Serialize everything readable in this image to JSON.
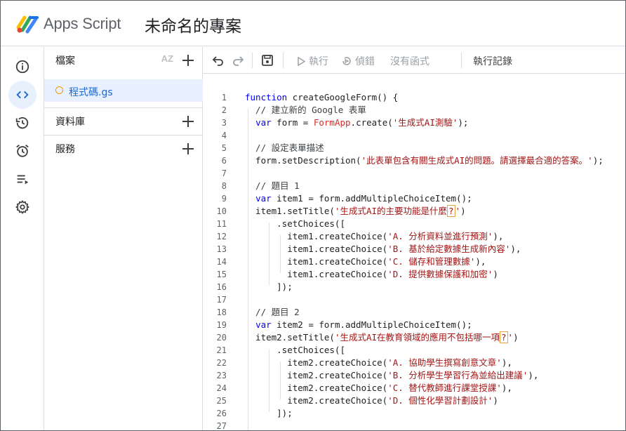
{
  "header": {
    "app_name": "Apps Script",
    "project_title": "未命名的專案"
  },
  "rail": {
    "items": [
      {
        "name": "overview",
        "icon": "info-icon"
      },
      {
        "name": "editor",
        "icon": "code-icon",
        "active": true
      },
      {
        "name": "versions",
        "icon": "history-icon"
      },
      {
        "name": "triggers",
        "icon": "alarm-icon"
      },
      {
        "name": "executions",
        "icon": "executions-list-icon"
      },
      {
        "name": "settings",
        "icon": "gear-icon"
      }
    ]
  },
  "files_panel": {
    "files_label": "檔案",
    "sort_label": "AZ",
    "file_name": "程式碼.gs",
    "libraries_label": "資料庫",
    "services_label": "服務"
  },
  "toolbar": {
    "run_label": "執行",
    "debug_label": "偵錯",
    "function_label": "沒有函式",
    "log_label": "執行記錄"
  },
  "colors": {
    "accent": "#1967d2",
    "active_bg": "#e8f0fe",
    "keyword": "#0000ff",
    "string": "#a31515",
    "file_dot": "#f29900"
  },
  "editor": {
    "lines": [
      {
        "n": "1",
        "parts": [
          [
            "kw",
            "function"
          ],
          [
            "t",
            " createGoogleForm() {"
          ]
        ]
      },
      {
        "n": "2",
        "parts": [
          [
            "cmt",
            "  // 建立新的 Google 表單"
          ]
        ]
      },
      {
        "n": "3",
        "parts": [
          [
            "t",
            "  "
          ],
          [
            "kw",
            "var"
          ],
          [
            "t",
            " form = "
          ],
          [
            "cls",
            "FormApp"
          ],
          [
            "t",
            ".create("
          ],
          [
            "str",
            "'生成式AI測驗'"
          ],
          [
            "t",
            ");"
          ]
        ]
      },
      {
        "n": "4",
        "parts": []
      },
      {
        "n": "5",
        "parts": [
          [
            "cmt",
            "  // 設定表單描述"
          ]
        ]
      },
      {
        "n": "6",
        "parts": [
          [
            "t",
            "  form.setDescription("
          ],
          [
            "str",
            "'此表單包含有關生成式AI的問題。請選擇最合適的答案。'"
          ],
          [
            "t",
            ");"
          ]
        ]
      },
      {
        "n": "7",
        "parts": []
      },
      {
        "n": "8",
        "parts": [
          [
            "cmt",
            "  // 題目 1"
          ]
        ]
      },
      {
        "n": "9",
        "parts": [
          [
            "t",
            "  "
          ],
          [
            "kw",
            "var"
          ],
          [
            "t",
            " item1 = form.addMultipleChoiceItem();"
          ]
        ]
      },
      {
        "n": "10",
        "parts": [
          [
            "t",
            "  item1.setTitle("
          ],
          [
            "str",
            "'生成式AI的主要功能是什麼"
          ],
          [
            "hl",
            "?"
          ],
          [
            "str",
            "'"
          ],
          [
            "t",
            ")"
          ]
        ]
      },
      {
        "n": "11",
        "parts": [
          [
            "t",
            "      .setChoices(["
          ]
        ]
      },
      {
        "n": "12",
        "parts": [
          [
            "t",
            "        item1.createChoice("
          ],
          [
            "str",
            "'A. 分析資料並進行預測'"
          ],
          [
            "t",
            "),"
          ]
        ]
      },
      {
        "n": "13",
        "parts": [
          [
            "t",
            "        item1.createChoice("
          ],
          [
            "str",
            "'B. 基於給定數據生成新內容'"
          ],
          [
            "t",
            "),"
          ]
        ]
      },
      {
        "n": "14",
        "parts": [
          [
            "t",
            "        item1.createChoice("
          ],
          [
            "str",
            "'C. 儲存和管理數據'"
          ],
          [
            "t",
            "),"
          ]
        ]
      },
      {
        "n": "15",
        "parts": [
          [
            "t",
            "        item1.createChoice("
          ],
          [
            "str",
            "'D. 提供數據保護和加密'"
          ],
          [
            "t",
            ")"
          ]
        ]
      },
      {
        "n": "16",
        "parts": [
          [
            "t",
            "      ]);"
          ]
        ]
      },
      {
        "n": "17",
        "parts": []
      },
      {
        "n": "18",
        "parts": [
          [
            "cmt",
            "  // 題目 2"
          ]
        ]
      },
      {
        "n": "19",
        "parts": [
          [
            "t",
            "  "
          ],
          [
            "kw",
            "var"
          ],
          [
            "t",
            " item2 = form.addMultipleChoiceItem();"
          ]
        ]
      },
      {
        "n": "20",
        "parts": [
          [
            "t",
            "  item2.setTitle("
          ],
          [
            "str",
            "'生成式AI在教育領域的應用不包括哪一項"
          ],
          [
            "hl",
            "?"
          ],
          [
            "str",
            "'"
          ],
          [
            "t",
            ")"
          ]
        ]
      },
      {
        "n": "21",
        "parts": [
          [
            "t",
            "      .setChoices(["
          ]
        ]
      },
      {
        "n": "22",
        "parts": [
          [
            "t",
            "        item2.createChoice("
          ],
          [
            "str",
            "'A. 協助學生撰寫創意文章'"
          ],
          [
            "t",
            "),"
          ]
        ]
      },
      {
        "n": "23",
        "parts": [
          [
            "t",
            "        item2.createChoice("
          ],
          [
            "str",
            "'B. 分析學生學習行為並給出建議'"
          ],
          [
            "t",
            "),"
          ]
        ]
      },
      {
        "n": "24",
        "parts": [
          [
            "t",
            "        item2.createChoice("
          ],
          [
            "str",
            "'C. 替代教師進行課堂授課'"
          ],
          [
            "t",
            "),"
          ]
        ]
      },
      {
        "n": "25",
        "parts": [
          [
            "t",
            "        item2.createChoice("
          ],
          [
            "str",
            "'D. 個性化學習計劃設計'"
          ],
          [
            "t",
            ")"
          ]
        ]
      },
      {
        "n": "26",
        "parts": [
          [
            "t",
            "      ]);"
          ]
        ]
      },
      {
        "n": "27",
        "parts": []
      }
    ]
  }
}
